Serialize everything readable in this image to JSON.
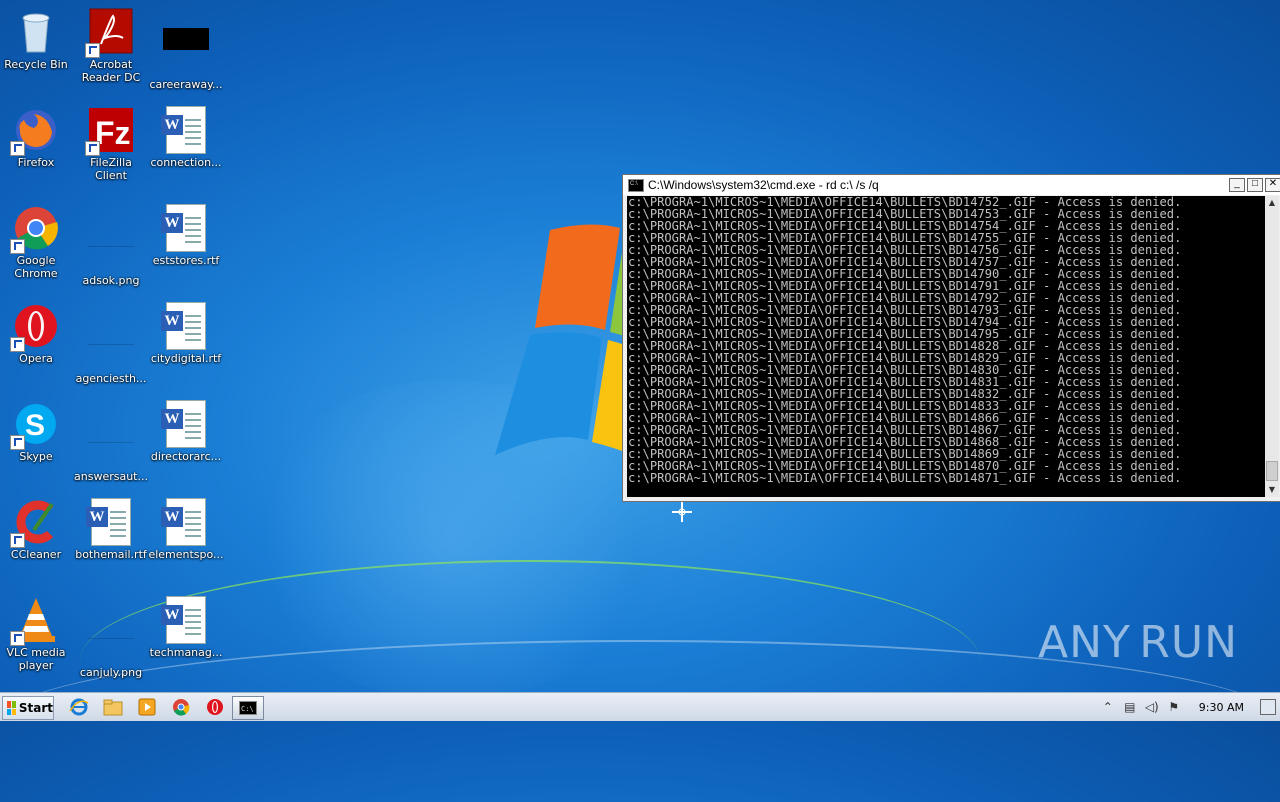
{
  "desktop": {
    "icons": [
      {
        "label": "Recycle Bin",
        "icon": "recycle-bin-icon"
      },
      {
        "label": "Acrobat Reader DC",
        "icon": "acrobat-icon"
      },
      {
        "label": "careeraway...",
        "icon": "file-icon"
      },
      {
        "label": "Firefox",
        "icon": "firefox-icon"
      },
      {
        "label": "FileZilla Client",
        "icon": "filezilla-icon"
      },
      {
        "label": "connection...",
        "icon": "word-doc-icon"
      },
      {
        "label": "Google Chrome",
        "icon": "chrome-icon"
      },
      {
        "label": "adsok.png",
        "icon": "image-file-icon"
      },
      {
        "label": "eststores.rtf",
        "icon": "word-doc-icon"
      },
      {
        "label": "Opera",
        "icon": "opera-icon"
      },
      {
        "label": "agenciesth...",
        "icon": "image-file-icon"
      },
      {
        "label": "citydigital.rtf",
        "icon": "word-doc-icon"
      },
      {
        "label": "Skype",
        "icon": "skype-icon"
      },
      {
        "label": "answersaut...",
        "icon": "image-file-icon"
      },
      {
        "label": "directorarc...",
        "icon": "word-doc-icon"
      },
      {
        "label": "CCleaner",
        "icon": "ccleaner-icon"
      },
      {
        "label": "bothemail.rtf",
        "icon": "word-doc-icon"
      },
      {
        "label": "elementspo...",
        "icon": "word-doc-icon"
      },
      {
        "label": "VLC media player",
        "icon": "vlc-icon"
      },
      {
        "label": "canjuly.png",
        "icon": "image-file-icon"
      },
      {
        "label": "techmanag...",
        "icon": "word-doc-icon"
      }
    ]
  },
  "cmd": {
    "title": "C:\\Windows\\system32\\cmd.exe - rd  c:\\ /s /q",
    "lines": [
      "c:\\PROGRA~1\\MICROS~1\\MEDIA\\OFFICE14\\BULLETS\\BD14752_.GIF - Access is denied.",
      "c:\\PROGRA~1\\MICROS~1\\MEDIA\\OFFICE14\\BULLETS\\BD14753_.GIF - Access is denied.",
      "c:\\PROGRA~1\\MICROS~1\\MEDIA\\OFFICE14\\BULLETS\\BD14754_.GIF - Access is denied.",
      "c:\\PROGRA~1\\MICROS~1\\MEDIA\\OFFICE14\\BULLETS\\BD14755_.GIF - Access is denied.",
      "c:\\PROGRA~1\\MICROS~1\\MEDIA\\OFFICE14\\BULLETS\\BD14756_.GIF - Access is denied.",
      "c:\\PROGRA~1\\MICROS~1\\MEDIA\\OFFICE14\\BULLETS\\BD14757_.GIF - Access is denied.",
      "c:\\PROGRA~1\\MICROS~1\\MEDIA\\OFFICE14\\BULLETS\\BD14790_.GIF - Access is denied.",
      "c:\\PROGRA~1\\MICROS~1\\MEDIA\\OFFICE14\\BULLETS\\BD14791_.GIF - Access is denied.",
      "c:\\PROGRA~1\\MICROS~1\\MEDIA\\OFFICE14\\BULLETS\\BD14792_.GIF - Access is denied.",
      "c:\\PROGRA~1\\MICROS~1\\MEDIA\\OFFICE14\\BULLETS\\BD14793_.GIF - Access is denied.",
      "c:\\PROGRA~1\\MICROS~1\\MEDIA\\OFFICE14\\BULLETS\\BD14794_.GIF - Access is denied.",
      "c:\\PROGRA~1\\MICROS~1\\MEDIA\\OFFICE14\\BULLETS\\BD14795_.GIF - Access is denied.",
      "c:\\PROGRA~1\\MICROS~1\\MEDIA\\OFFICE14\\BULLETS\\BD14828_.GIF - Access is denied.",
      "c:\\PROGRA~1\\MICROS~1\\MEDIA\\OFFICE14\\BULLETS\\BD14829_.GIF - Access is denied.",
      "c:\\PROGRA~1\\MICROS~1\\MEDIA\\OFFICE14\\BULLETS\\BD14830_.GIF - Access is denied.",
      "c:\\PROGRA~1\\MICROS~1\\MEDIA\\OFFICE14\\BULLETS\\BD14831_.GIF - Access is denied.",
      "c:\\PROGRA~1\\MICROS~1\\MEDIA\\OFFICE14\\BULLETS\\BD14832_.GIF - Access is denied.",
      "c:\\PROGRA~1\\MICROS~1\\MEDIA\\OFFICE14\\BULLETS\\BD14833_.GIF - Access is denied.",
      "c:\\PROGRA~1\\MICROS~1\\MEDIA\\OFFICE14\\BULLETS\\BD14866_.GIF - Access is denied.",
      "c:\\PROGRA~1\\MICROS~1\\MEDIA\\OFFICE14\\BULLETS\\BD14867_.GIF - Access is denied.",
      "c:\\PROGRA~1\\MICROS~1\\MEDIA\\OFFICE14\\BULLETS\\BD14868_.GIF - Access is denied.",
      "c:\\PROGRA~1\\MICROS~1\\MEDIA\\OFFICE14\\BULLETS\\BD14869_.GIF - Access is denied.",
      "c:\\PROGRA~1\\MICROS~1\\MEDIA\\OFFICE14\\BULLETS\\BD14870_.GIF - Access is denied.",
      "c:\\PROGRA~1\\MICROS~1\\MEDIA\\OFFICE14\\BULLETS\\BD14871_.GIF - Access is denied."
    ]
  },
  "taskbar": {
    "start_label": "Start",
    "pinned": [
      "internet-explorer-icon",
      "file-explorer-icon",
      "media-player-icon",
      "chrome-icon",
      "opera-icon",
      "cmd-icon"
    ],
    "clock": "9:30 AM"
  },
  "watermark": {
    "left": "ANY",
    "right": "RUN"
  }
}
